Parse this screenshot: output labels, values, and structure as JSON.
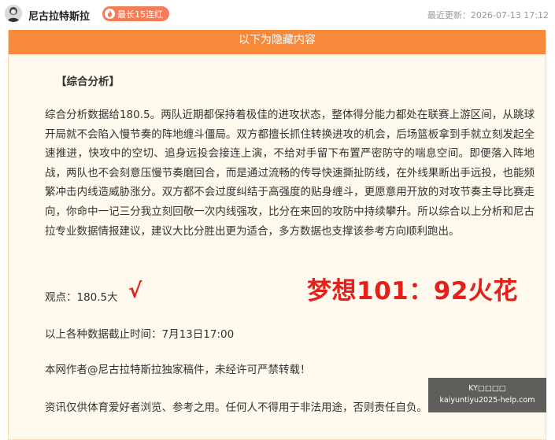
{
  "header": {
    "author_name": "尼古拉特斯拉",
    "streak_badge": "最长15连红",
    "last_updated": "最近更新：2026-07-13 17:12"
  },
  "panel": {
    "hidden_banner": "以下为隐藏内容",
    "section_title": "【综合分析】",
    "analysis_text": "综合分析数据给180.5。两队近期都保持着极佳的进攻状态，整体得分能力都处在联赛上游区间，从跳球开局就不会陷入慢节奏的阵地缠斗僵局。双方都擅长抓住转换进攻的机会，后场篮板拿到手就立刻发起全速推进，快攻中的空切、追身远投会接连上演，不给对手留下布置严密防守的喘息空间。即便落入阵地战，两队也不会刻意压慢节奏磨回合，而是通过流畅的传导快速撕扯防线，在外线果断出手远投，也能频繁冲击内线造威胁涨分。双方都不会过度纠结于高强度的贴身缠斗，更愿意用开放的对攻节奏主导比赛走向，你命中一记三分我立刻回敬一次内线强攻，比分在来回的攻防中持续攀升。所以综合以上分析和尼古拉专业数据情报建议，建议大比分胜出更为适合，多方数据也支撑该参考方向顺利跑出。",
    "viewpoint": "观点：180.5大",
    "check_mark": "√",
    "deadline": "以上各种数据截止时间：7月13日17:00",
    "copyright": "本网作者@尼古拉特斯拉独家稿件，未经许可严禁转载！",
    "disclaimer": "资讯仅供体育爱好者浏览、参考之用。任何人不得用于非法用途，否则责任自负。"
  },
  "overlay": {
    "score_watermark": "梦想101：92火花",
    "ad_title": "KY□□□□",
    "ad_url": "kaiyuntiyu2025-help.com"
  },
  "colors": {
    "accent_orange": "#f7893a",
    "badge_orange": "#f47c57",
    "panel_bg": "#fff9ee",
    "watermark_red": "#e5201b"
  }
}
